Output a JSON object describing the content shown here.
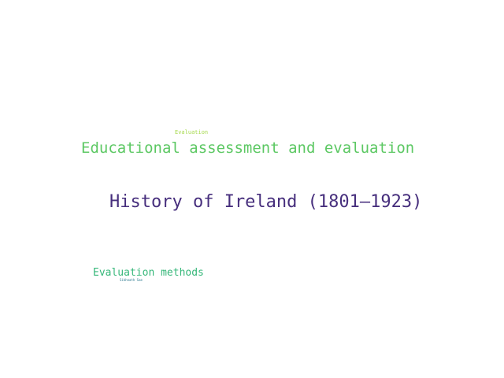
{
  "word_cloud": {
    "words": [
      {
        "id": "evaluation",
        "text": "Evaluation",
        "color": "#a6d94c"
      },
      {
        "id": "educational",
        "text": "Educational assessment and evaluation",
        "color": "#5cc863"
      },
      {
        "id": "history",
        "text": "History of Ireland (1801–1923)",
        "color": "#472f7d"
      },
      {
        "id": "methods",
        "text": "Evaluation methods",
        "color": "#35b779"
      },
      {
        "id": "small",
        "text": "Sikhnath Sae",
        "color": "#2a788e"
      }
    ]
  }
}
